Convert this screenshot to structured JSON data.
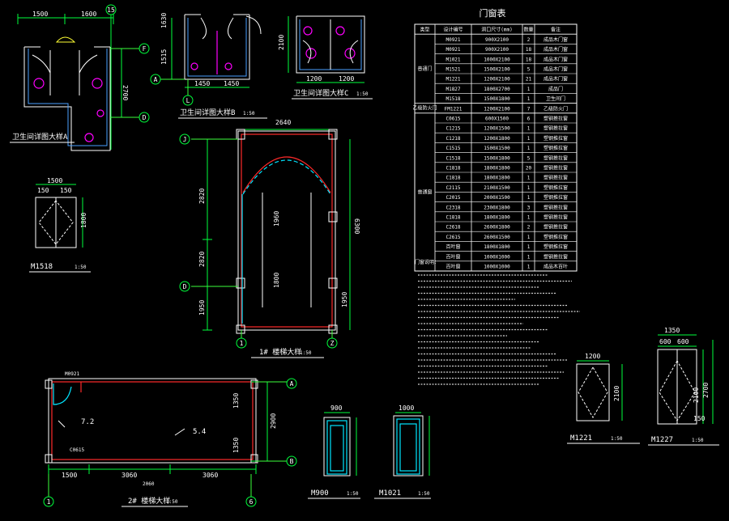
{
  "drawing": {
    "views": {
      "bath_a": {
        "title": "卫生间详图大样A",
        "dims_top": [
          "1500",
          "1600"
        ],
        "dims_side": [
          "2700"
        ],
        "grid": [
          "F",
          "D",
          "15"
        ]
      },
      "bath_b": {
        "title": "卫生间详图大样B",
        "scale": "1:50",
        "dims_side": [
          "1630",
          "1515"
        ],
        "dims_bottom": [
          "1450",
          "1450"
        ],
        "grid": [
          "A",
          "L"
        ]
      },
      "bath_c": {
        "title": "卫生间详图大样C",
        "scale": "1:50",
        "dims_side": [
          "2100"
        ],
        "dims_bottom": [
          "1200",
          "1200"
        ]
      },
      "m1518": {
        "title": "M1518",
        "scale": "1:50",
        "dims_top": [
          "1500",
          "150",
          "150"
        ],
        "dims_side": [
          "1800"
        ]
      },
      "plan1": {
        "title": "1# 楼梯大样",
        "scale": "1:50",
        "grid": [
          "J",
          "D",
          "1",
          "Z"
        ],
        "dims_left": [
          "2820",
          "2820",
          "1950"
        ],
        "dims_inner": [
          "1960",
          "1800"
        ],
        "dims_right": [
          "6300",
          "1950"
        ],
        "top_dim": "2640"
      },
      "plan2": {
        "title": "2# 楼梯大样",
        "scale": "1:50",
        "labels": [
          "7.2",
          "5.4"
        ],
        "dims_bottom": [
          "1500",
          "3060",
          "3060"
        ],
        "total": "2060",
        "dims_right": [
          "1350",
          "1350",
          "2900"
        ],
        "grid": [
          "A",
          "B",
          "1",
          "6"
        ]
      },
      "m900": {
        "title": "M900",
        "scale": "1:50",
        "dims": [
          "900"
        ]
      },
      "m1021": {
        "title": "M1021",
        "scale": "1:50",
        "dims": [
          "1000"
        ]
      },
      "m1221": {
        "title": "M1221",
        "scale": "1:50",
        "dims": [
          "1200",
          "2100"
        ]
      },
      "m1227": {
        "title": "M1227",
        "scale": "1:50",
        "dims": [
          "1350",
          "600",
          "600",
          "2100",
          "2700",
          "150"
        ]
      }
    },
    "door_window_table": {
      "title": "门窗表",
      "headers": [
        "类型",
        "设计编号",
        "洞口尺寸(mm)",
        "数量",
        "备注"
      ],
      "groups": [
        {
          "type": "普通门",
          "rows": [
            [
              "M0921",
              "900X2100",
              "2",
              "成品木门窗"
            ],
            [
              "M0921",
              "900X2100",
              "18",
              "成品木门窗"
            ],
            [
              "M1021",
              "1000X2100",
              "18",
              "成品木门窗"
            ],
            [
              "M1521",
              "1500X2100",
              "5",
              "成品木门窗"
            ],
            [
              "M1221",
              "1200X2100",
              "21",
              "成品木门窗"
            ],
            [
              "M1827",
              "1800X2700",
              "1",
              "成品门"
            ],
            [
              "M1518",
              "1500X1800",
              "1",
              "卫生间门"
            ]
          ]
        },
        {
          "type": "乙级防火门",
          "rows": [
            [
              "FM1221",
              "1200X2100",
              "7",
              "乙级防火门"
            ]
          ]
        },
        {
          "type": "普通窗",
          "rows": [
            [
              "C0615",
              "600X1500",
              "6",
              "塑钢推拉窗"
            ],
            [
              "C1215",
              "1200X1500",
              "1",
              "塑钢推拉窗"
            ],
            [
              "C1218",
              "1200X1800",
              "1",
              "塑钢推拉窗"
            ],
            [
              "C1515",
              "1500X1500",
              "1",
              "塑钢推拉窗"
            ],
            [
              "C1518",
              "1500X1800",
              "5",
              "塑钢推拉窗"
            ],
            [
              "C1818",
              "1800X1800",
              "20",
              "塑钢推拉窗"
            ],
            [
              "C1818",
              "1800X1800",
              "1",
              "塑钢推拉窗"
            ],
            [
              "C2115",
              "2100X1500",
              "1",
              "塑钢推拉窗"
            ],
            [
              "C2015",
              "2000X1500",
              "1",
              "塑钢推拉窗"
            ],
            [
              "C2318",
              "2300X1800",
              "3",
              "塑钢推拉窗"
            ],
            [
              "C1818",
              "1800X1800",
              "1",
              "塑钢推拉窗"
            ],
            [
              "C2618",
              "2600X1800",
              "2",
              "塑钢推拉窗"
            ],
            [
              "C2615",
              "2600X1500",
              "1",
              "塑钢推拉窗"
            ],
            [
              "百叶窗",
              "1800X1800",
              "1",
              "塑钢推拉窗"
            ],
            [
              "百叶窗",
              "1000X1000",
              "1",
              "塑钢推拉窗"
            ],
            [
              "百叶窗",
              "1000X1000",
              "1",
              "成品木百叶"
            ]
          ]
        }
      ],
      "notes_title": "门窗说明："
    }
  }
}
